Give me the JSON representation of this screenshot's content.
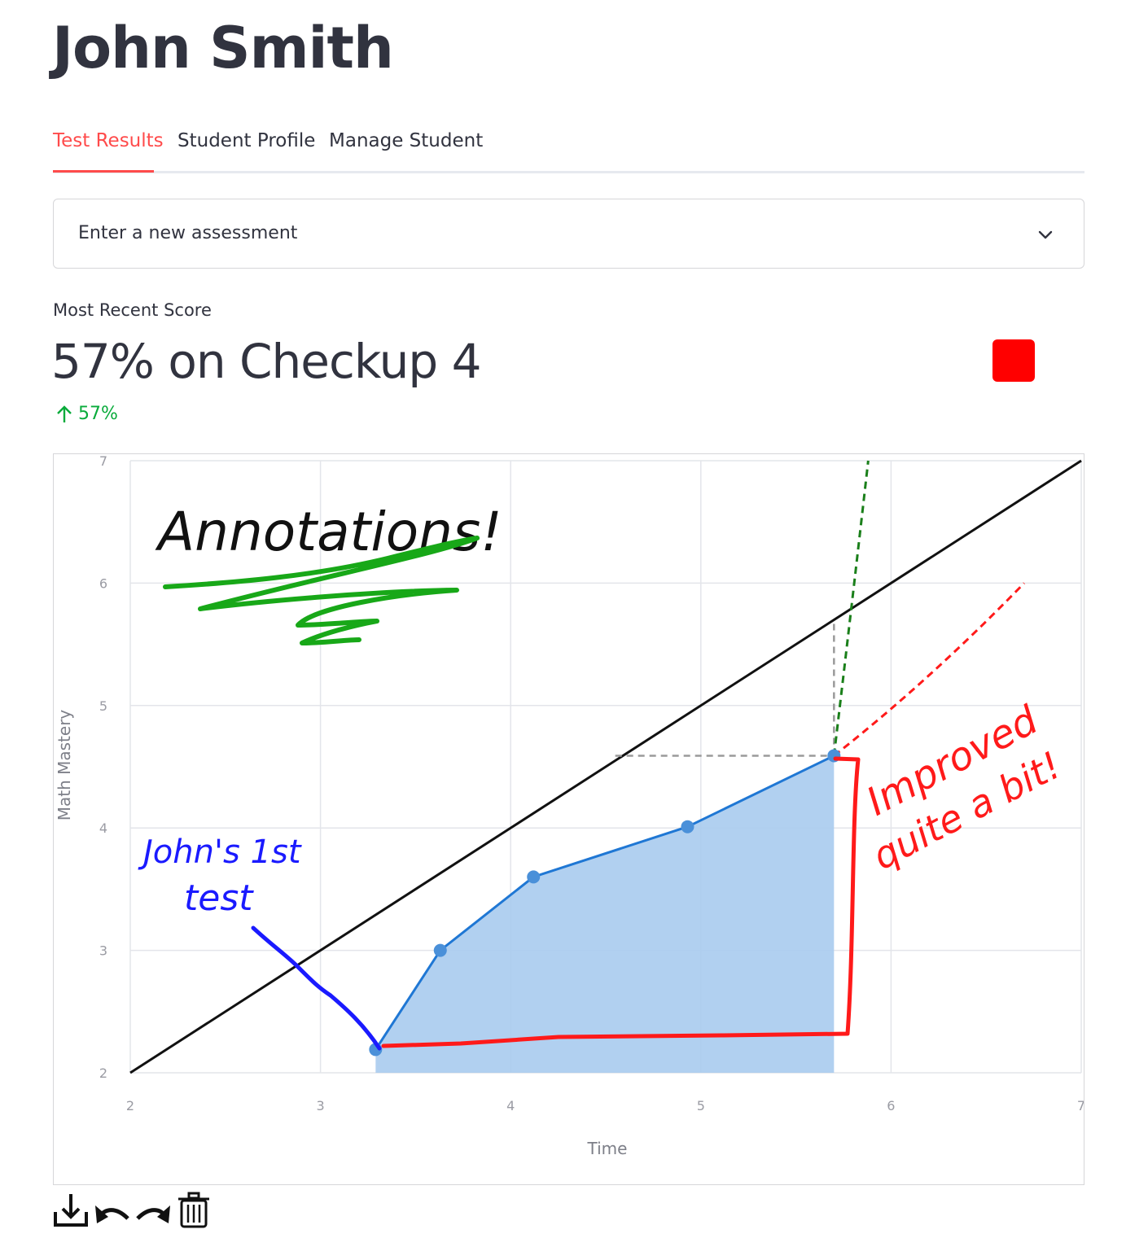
{
  "page": {
    "title": "John Smith"
  },
  "tabs": [
    {
      "label": "Test Results",
      "active": true
    },
    {
      "label": "Student Profile",
      "active": false
    },
    {
      "label": "Manage Student",
      "active": false
    }
  ],
  "expander": {
    "label": "Enter a new assessment"
  },
  "metric": {
    "label": "Most Recent Score",
    "value": "57% on Checkup 4",
    "delta": "57%",
    "delta_direction": "up",
    "status_color": "#ff0000"
  },
  "colors": {
    "accent": "#ff4b4b",
    "delta_green": "#09ab3b",
    "series_line": "#1f77d4",
    "series_fill": "#a9cbee",
    "annotation_green": "#18a818",
    "annotation_blue": "#1a1aff",
    "annotation_red": "#ff1a1a"
  },
  "chart_data": {
    "type": "line",
    "xlabel": "Time",
    "ylabel": "Math Mastery",
    "xlim": [
      2,
      7
    ],
    "ylim": [
      2,
      7
    ],
    "xticks": [
      "2",
      "3",
      "4",
      "5",
      "6",
      "7"
    ],
    "yticks": [
      "2",
      "3",
      "4",
      "5",
      "6",
      "7"
    ],
    "grid": true,
    "series": [
      {
        "x": [
          3.29,
          3.63,
          4.12,
          4.93,
          5.7
        ],
        "y": [
          2.19,
          3.0,
          3.6,
          4.01,
          4.59
        ],
        "fill": "tozeroy"
      }
    ],
    "reference_line": {
      "x": [
        2,
        7
      ],
      "y": [
        2,
        7
      ]
    },
    "dashed_guides": {
      "horizontal": {
        "x": [
          4.55,
          5.7
        ],
        "y": 4.59
      },
      "vertical": {
        "x": 5.7,
        "y": [
          4.59,
          5.7
        ]
      }
    },
    "projections": [
      {
        "color": "#1a7f1a",
        "x": [
          5.7,
          5.8,
          5.88
        ],
        "y": [
          4.59,
          5.9,
          7.0
        ]
      },
      {
        "color": "#ff1a1a",
        "x": [
          5.7,
          6.2,
          6.7
        ],
        "y": [
          4.59,
          5.2,
          6.0
        ]
      }
    ]
  },
  "annotations": {
    "title_note": "Annotations!",
    "first_test_note_line1": "John's 1st",
    "first_test_note_line2": "test",
    "improved_note_line1": "Improved",
    "improved_note_line2": "quite a bit!"
  },
  "toolbar": {
    "download_icon": "download-icon",
    "undo_icon": "undo-icon",
    "redo_icon": "redo-icon",
    "delete_icon": "trash-icon"
  }
}
